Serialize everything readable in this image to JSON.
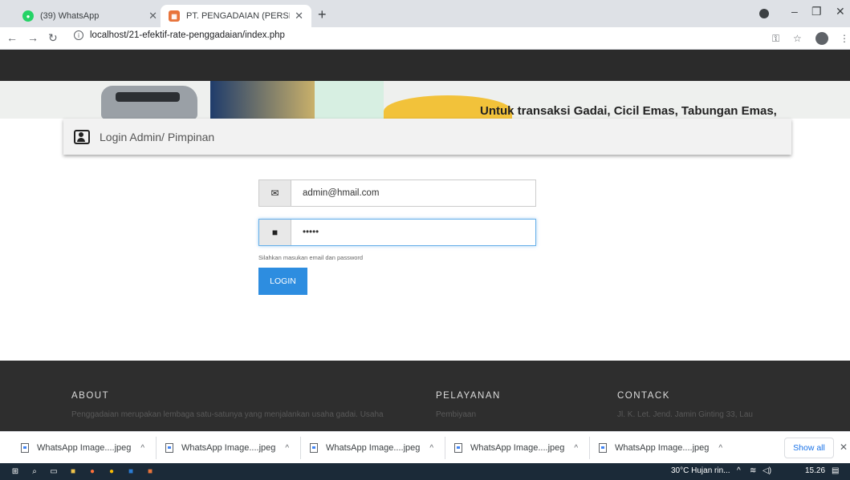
{
  "browser": {
    "tabs": [
      {
        "title": "(39) WhatsApp",
        "favicon_color": "#25d366"
      },
      {
        "title": "PT. PENGADAIAN (PERSERO)",
        "favicon_color": "#e8743b"
      }
    ],
    "url": "localhost/21-efektif-rate-penggadaian/index.php"
  },
  "banner": {
    "text": "Untuk transaksi Gadai, Cicil Emas, Tabungan Emas,"
  },
  "login": {
    "title": "Login Admin/ Pimpinan",
    "email_value": "admin@hmail.com",
    "password_value": "•••••",
    "help_text": "Silahkan masukan email dan password",
    "button_label": "LOGIN"
  },
  "footer": {
    "about_heading": "ABOUT",
    "about_text": "Penggadaian merupakan lembaga satu-satunya yang menjalankan usaha gadai. Usaha",
    "services_heading": "PELAYANAN",
    "services_text": "Pembiyaan",
    "contact_heading": "CONTACK",
    "contact_text": "Jl. K. Let. Jend. Jamin Ginting 33, Lau"
  },
  "downloads": {
    "items": [
      "WhatsApp Image....jpeg",
      "WhatsApp Image....jpeg",
      "WhatsApp Image....jpeg",
      "WhatsApp Image....jpeg",
      "WhatsApp Image....jpeg"
    ],
    "show_all": "Show all"
  },
  "taskbar": {
    "weather": "30°C  Hujan rin...",
    "time": "15.26"
  }
}
